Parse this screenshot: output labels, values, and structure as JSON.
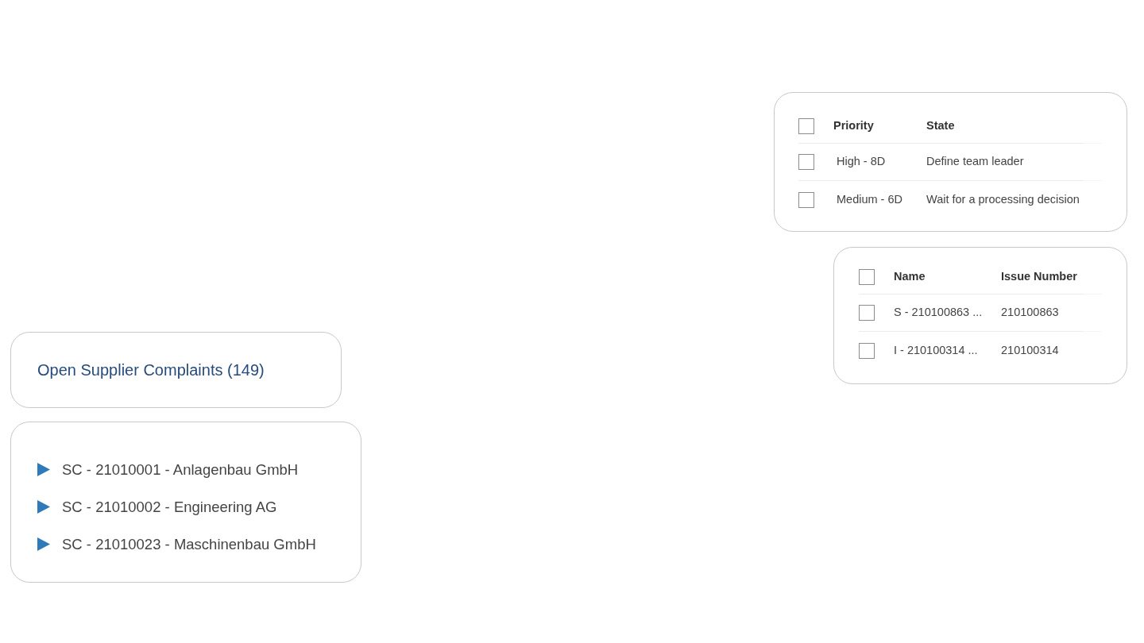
{
  "state_table": {
    "header_checked": false,
    "columns": [
      {
        "label": "Priority"
      },
      {
        "label": "State"
      }
    ],
    "rows": [
      {
        "checked": false,
        "cells": [
          "High - 8D",
          "Define team leader"
        ]
      },
      {
        "checked": false,
        "cells": [
          "Medium - 6D",
          "Wait for a processing decision"
        ]
      }
    ]
  },
  "issue_table": {
    "header_checked": false,
    "columns": [
      {
        "label": "Name"
      },
      {
        "label": "Issue Number"
      }
    ],
    "rows": [
      {
        "checked": false,
        "cells": [
          "S - 210100863 ...",
          "210100863"
        ]
      },
      {
        "checked": false,
        "cells": [
          "I - 210100314 ...",
          "210100314"
        ]
      }
    ]
  },
  "summary_tile": {
    "title": "Open Supplier Complaints (149)"
  },
  "complaints_list": {
    "items": [
      {
        "label": "SC - 21010001 - Anlagenbau GmbH",
        "expanded": false
      },
      {
        "label": "SC - 21010002 - Engineering AG",
        "expanded": false
      },
      {
        "label": "SC - 21010023 - Maschinenbau GmbH",
        "expanded": false
      }
    ]
  }
}
